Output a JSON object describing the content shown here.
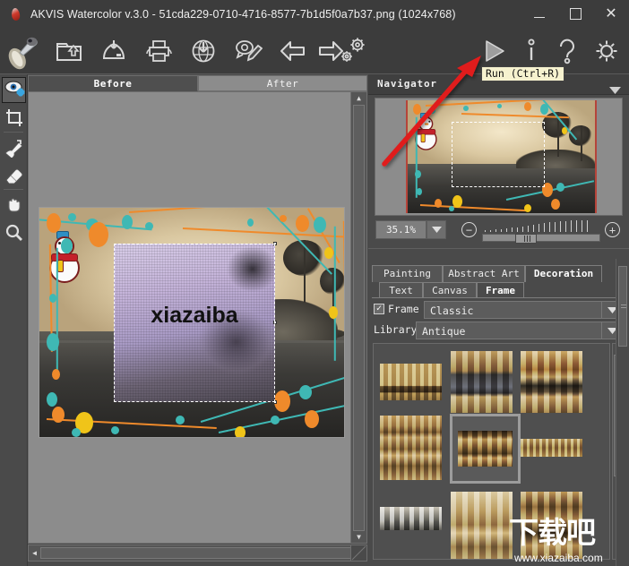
{
  "window": {
    "title": "AKVIS Watercolor v.3.0 - 51cda229-0710-4716-8577-7b1d5f0a7b37.png (1024x768)",
    "app_icon": "watercolor-drop-icon",
    "minimize_label": "–",
    "maximize_label": "",
    "close_label": "✕"
  },
  "toolbar": {
    "items": [
      {
        "name": "brush-logo-icon",
        "label": "AKVIS"
      },
      {
        "name": "open-image-icon",
        "label": "Open Image"
      },
      {
        "name": "save-image-icon",
        "label": "Save Image"
      },
      {
        "name": "print-image-icon",
        "label": "Print Image"
      },
      {
        "name": "publish-web-icon",
        "label": "Publish"
      },
      {
        "name": "share-comment-icon",
        "label": "Share"
      },
      {
        "name": "undo-icon",
        "label": "Undo"
      },
      {
        "name": "redo-icon",
        "label": "Redo"
      },
      {
        "name": "preferences-icon",
        "label": "Preferences"
      },
      {
        "name": "run-icon",
        "label": "Run"
      },
      {
        "name": "info-icon",
        "label": "Info"
      },
      {
        "name": "help-icon",
        "label": "Help"
      },
      {
        "name": "settings-icon",
        "label": "Settings"
      }
    ],
    "tooltip": "Run (Ctrl+R)"
  },
  "left_tools": [
    {
      "name": "quick-preview-tool",
      "label": "Quick Preview",
      "active": true
    },
    {
      "name": "crop-tool",
      "label": "Crop"
    },
    {
      "name": "history-brush-tool",
      "label": "History Brush"
    },
    {
      "name": "eraser-tool",
      "label": "Eraser"
    },
    {
      "name": "hand-tool",
      "label": "Hand"
    },
    {
      "name": "zoom-tool",
      "label": "Zoom"
    }
  ],
  "canvas": {
    "tabs": [
      {
        "label": "Before",
        "active": true
      },
      {
        "label": "After",
        "active": false
      }
    ],
    "preview_text": "xiazaiba"
  },
  "navigator": {
    "title": "Navigator",
    "collapse_icon": "chevron-down-icon",
    "zoom_value": "35.1%",
    "zoom_dropdown_icon": "chevron-down-icon",
    "zoom_out_label": "−",
    "zoom_in_label": "+"
  },
  "settings_panel": {
    "main_tabs": [
      {
        "label": "Painting",
        "active": false
      },
      {
        "label": "Abstract Art",
        "active": false
      },
      {
        "label": "Decoration",
        "active": true
      }
    ],
    "sub_tabs": [
      {
        "label": "Text",
        "active": false
      },
      {
        "label": "Canvas",
        "active": false
      },
      {
        "label": "Frame",
        "active": true
      }
    ],
    "frame_checkbox": {
      "label": "Frame",
      "checked": true,
      "check_glyph": "✓"
    },
    "frame_value": "Classic",
    "library_label": "Library",
    "library_value": "Antique",
    "dropdown_icon": "chevron-down-icon",
    "gallery": {
      "selected_index": 4,
      "items": [
        {
          "name": "frame-thumb-swans"
        },
        {
          "name": "frame-thumb-arches-dark"
        },
        {
          "name": "frame-thumb-arches-gold"
        },
        {
          "name": "frame-thumb-rope-ribs"
        },
        {
          "name": "frame-thumb-acanthus"
        },
        {
          "name": "frame-thumb-slim-scroll"
        },
        {
          "name": "frame-thumb-wave-band"
        },
        {
          "name": "frame-thumb-cherubs"
        },
        {
          "name": "frame-thumb-egg-dart"
        }
      ]
    }
  },
  "watermark": {
    "text_cn": "下载吧",
    "url": "www.xiazaiba.com"
  },
  "colors": {
    "window_bg": "#4a4a4a",
    "titlebar_bg": "#3c3c3c",
    "canvas_bg": "#8c8c8c",
    "accent_red": "#e01b1b",
    "tooltip_bg": "#f6f2cf"
  }
}
